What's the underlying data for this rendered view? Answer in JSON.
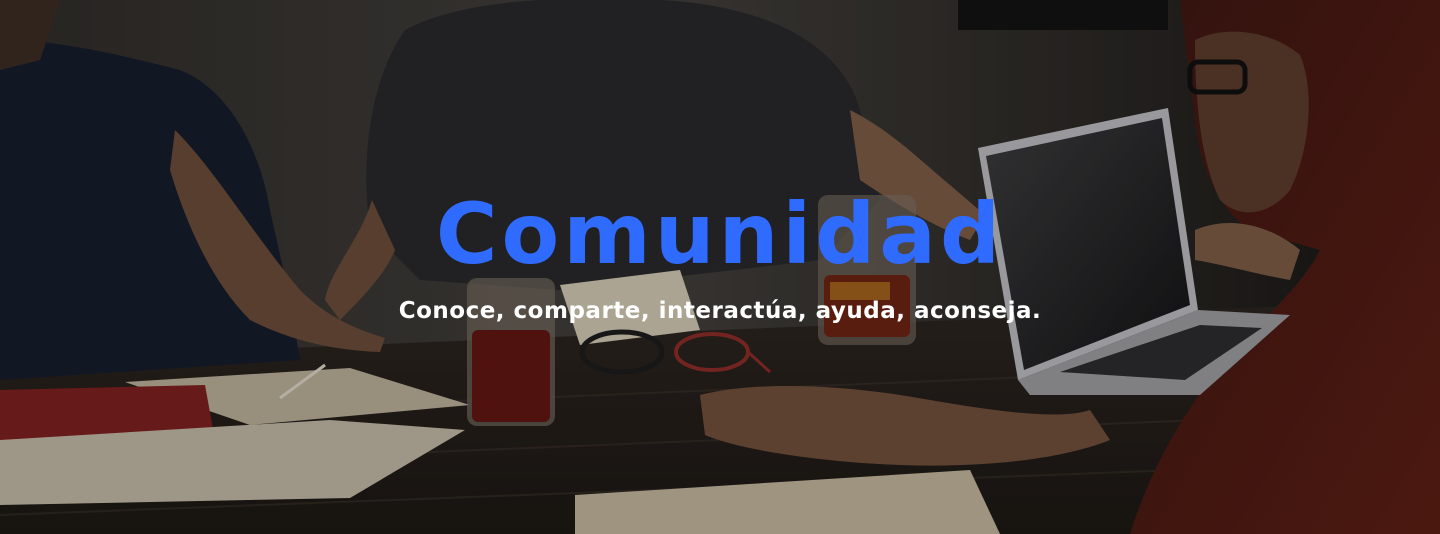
{
  "hero": {
    "title": "Comunidad",
    "subtitle": "Conoce, comparte, interactúa, ayuda, aconseja.",
    "title_color": "#2f6bff",
    "subtitle_color": "#ffffff"
  }
}
